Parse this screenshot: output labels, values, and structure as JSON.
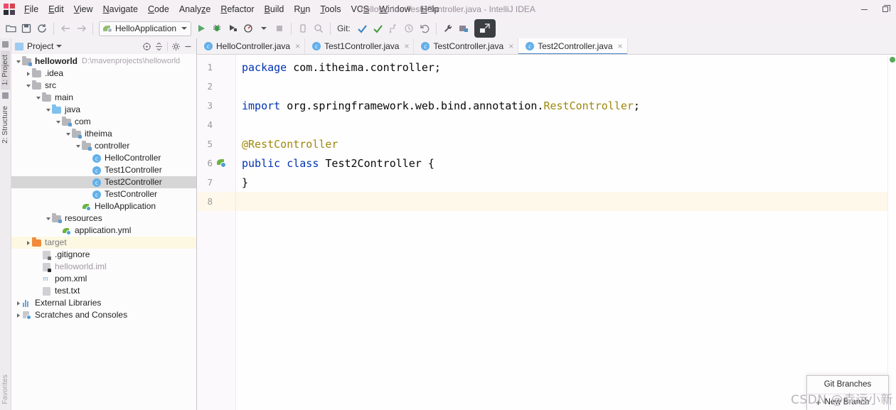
{
  "window": {
    "title": "helloworld - Test2Controller.java - IntelliJ IDEA",
    "minimize_label": "Minimize",
    "restore_label": "Restore"
  },
  "menubar": {
    "app_icon": "intellij-logo-icon",
    "items": [
      {
        "label": "File"
      },
      {
        "label": "Edit"
      },
      {
        "label": "View"
      },
      {
        "label": "Navigate"
      },
      {
        "label": "Code"
      },
      {
        "label": "Analyze"
      },
      {
        "label": "Refactor"
      },
      {
        "label": "Build"
      },
      {
        "label": "Run"
      },
      {
        "label": "Tools"
      },
      {
        "label": "VCS"
      },
      {
        "label": "Window"
      },
      {
        "label": "Help"
      }
    ]
  },
  "toolbar": {
    "open_icon": "open-folder-icon",
    "save_icon": "save-icon",
    "sync_icon": "refresh-icon",
    "back_icon": "arrow-left-icon",
    "forward_icon": "arrow-right-icon",
    "run_config": "HelloApplication",
    "run_config_icon": "spring-boot-icon",
    "run_icon": "run-play-icon",
    "debug_icon": "debug-bug-icon",
    "run_coverage_icon": "run-with-coverage-icon",
    "profile_icon": "profiler-icon",
    "stop_icon": "stop-icon",
    "device_icon": "device-manager-icon",
    "search_everywhere_icon": "search-icon",
    "git_label": "Git:",
    "git_update_icon": "git-update-project-icon",
    "git_commit_icon": "git-commit-check-icon",
    "git_push_icon": "git-push-icon",
    "git_history_icon": "git-history-clock-icon",
    "git_rollback_icon": "git-rollback-icon",
    "settings_icon": "wrench-settings-icon",
    "structure_icon": "project-structure-icon",
    "overlay_icon": "restore-window-icon"
  },
  "left_strip": {
    "tabs": [
      {
        "label": "1: Project",
        "selected": true
      },
      {
        "label": "2: Structure",
        "selected": false
      }
    ],
    "bottom_tab": {
      "label": "Favorites"
    }
  },
  "project_panel": {
    "title": "Project",
    "panel_icon": "project-view-icon",
    "locate_icon": "scroll-from-source-icon",
    "collapse_icon": "collapse-all-icon",
    "settings_icon": "gear-icon",
    "hide_icon": "hide-panel-icon",
    "tree": [
      {
        "label": "helloworld",
        "path": "D:\\mavenprojects\\helloworld",
        "indent": 0,
        "arrow": "open",
        "icon": "module-folder-icon",
        "bold": true
      },
      {
        "label": ".idea",
        "indent": 1,
        "arrow": "closed",
        "icon": "folder-icon"
      },
      {
        "label": "src",
        "indent": 1,
        "arrow": "open",
        "icon": "folder-icon"
      },
      {
        "label": "main",
        "indent": 2,
        "arrow": "open",
        "icon": "folder-icon"
      },
      {
        "label": "java",
        "indent": 3,
        "arrow": "open",
        "icon": "source-folder-icon"
      },
      {
        "label": "com",
        "indent": 4,
        "arrow": "open",
        "icon": "package-folder-icon"
      },
      {
        "label": "itheima",
        "indent": 5,
        "arrow": "open",
        "icon": "package-folder-icon"
      },
      {
        "label": "controller",
        "indent": 6,
        "arrow": "open",
        "icon": "package-folder-icon"
      },
      {
        "label": "HelloController",
        "indent": 7,
        "arrow": "none",
        "icon": "java-class-icon"
      },
      {
        "label": "Test1Controller",
        "indent": 7,
        "arrow": "none",
        "icon": "java-class-icon"
      },
      {
        "label": "Test2Controller",
        "indent": 7,
        "arrow": "none",
        "icon": "java-class-icon",
        "selected": true
      },
      {
        "label": "TestController",
        "indent": 7,
        "arrow": "none",
        "icon": "java-class-icon"
      },
      {
        "label": "HelloApplication",
        "indent": 6,
        "arrow": "none",
        "icon": "spring-boot-class-icon"
      },
      {
        "label": "resources",
        "indent": 3,
        "arrow": "open",
        "icon": "resources-folder-icon"
      },
      {
        "label": "application.yml",
        "indent": 4,
        "arrow": "none",
        "icon": "spring-yaml-icon"
      },
      {
        "label": "target",
        "indent": 1,
        "arrow": "closed",
        "icon": "excluded-folder-icon",
        "highlight": true,
        "muted": true
      },
      {
        "label": ".gitignore",
        "indent": 2,
        "arrow": "none",
        "icon": "gitignore-file-icon"
      },
      {
        "label": "helloworld.iml",
        "indent": 2,
        "arrow": "none",
        "icon": "iml-file-icon",
        "muted": true
      },
      {
        "label": "pom.xml",
        "indent": 2,
        "arrow": "none",
        "icon": "maven-pom-icon"
      },
      {
        "label": "test.txt",
        "indent": 2,
        "arrow": "none",
        "icon": "text-file-icon"
      },
      {
        "label": "External Libraries",
        "indent": 0,
        "arrow": "closed",
        "icon": "libraries-icon"
      },
      {
        "label": "Scratches and Consoles",
        "indent": 0,
        "arrow": "closed",
        "icon": "scratches-icon"
      }
    ]
  },
  "editor_tabs": [
    {
      "label": "HelloController.java",
      "icon": "java-class-icon",
      "active": false,
      "close": "×"
    },
    {
      "label": "Test1Controller.java",
      "icon": "java-class-icon",
      "active": false,
      "close": "×"
    },
    {
      "label": "TestController.java",
      "icon": "java-class-icon",
      "active": false,
      "close": "×"
    },
    {
      "label": "Test2Controller.java",
      "icon": "java-class-icon",
      "active": true,
      "close": "×"
    }
  ],
  "editor": {
    "gutter_bean_icon": "spring-bean-gutter-icon",
    "line_numbers": [
      "1",
      "2",
      "3",
      "4",
      "5",
      "6",
      "7",
      "8"
    ],
    "current_line": 8,
    "bean_line": 6,
    "lines": [
      {
        "n": "1",
        "tokens": [
          {
            "t": "package",
            "c": "kw"
          },
          {
            "t": " com.itheima.controller;",
            "c": "pln"
          }
        ]
      },
      {
        "n": "2",
        "tokens": []
      },
      {
        "n": "3",
        "tokens": [
          {
            "t": "import",
            "c": "kw"
          },
          {
            "t": " org.springframework.web.bind.annotation.",
            "c": "pln"
          },
          {
            "t": "RestController",
            "c": "typ"
          },
          {
            "t": ";",
            "c": "pln"
          }
        ]
      },
      {
        "n": "4",
        "tokens": []
      },
      {
        "n": "5",
        "tokens": [
          {
            "t": "@RestController",
            "c": "ann"
          }
        ]
      },
      {
        "n": "6",
        "tokens": [
          {
            "t": "public",
            "c": "kw"
          },
          {
            "t": " ",
            "c": "pln"
          },
          {
            "t": "class",
            "c": "kw"
          },
          {
            "t": " Test2Controller {",
            "c": "pln"
          }
        ]
      },
      {
        "n": "7",
        "tokens": [
          {
            "t": "}",
            "c": "pln"
          }
        ]
      },
      {
        "n": "8",
        "tokens": []
      }
    ],
    "inspection_status": "ok-green"
  },
  "git_branches_popup": {
    "title": "Git Branches",
    "new_branch": "New Branch",
    "new_branch_plus": "+"
  },
  "watermark": "CSDN @幸运小新",
  "colors": {
    "accent_blue": "#4a88c7",
    "keyword_blue": "#0033b3",
    "annotation_gold": "#9e880d",
    "spring_green": "#6db33f",
    "selection_gray": "#d6d6d6",
    "highlight_cream": "#fdf8ea"
  }
}
